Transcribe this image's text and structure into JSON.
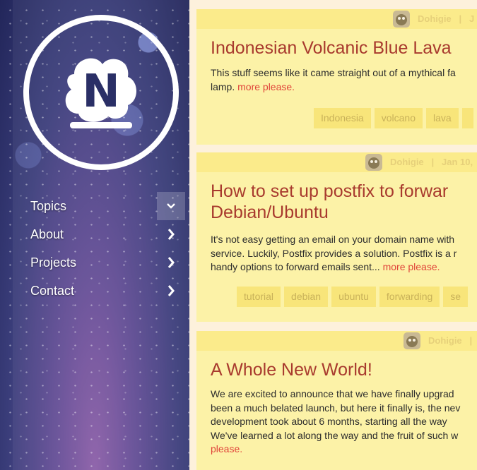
{
  "sidebar": {
    "logo_letter": "N",
    "nav": [
      {
        "label": "Topics",
        "icon": "chevron-down-icon"
      },
      {
        "label": "About",
        "icon": "chevron-right-icon"
      },
      {
        "label": "Projects",
        "icon": "chevron-right-icon"
      },
      {
        "label": "Contact",
        "icon": "chevron-right-icon"
      }
    ]
  },
  "posts": [
    {
      "author": "Dohigie",
      "date": "J",
      "title": "Indonesian Volcanic Blue Lava",
      "excerpt_lines": [
        "This stuff seems like it came straight out of a mythical fa",
        "lamp."
      ],
      "more": "more please.",
      "tags": [
        "Indonesia",
        "volcano",
        "lava"
      ]
    },
    {
      "author": "Dohigie",
      "date": "Jan 10,",
      "title_lines": [
        "How to set up postfix to forwar",
        "Debian/Ubuntu"
      ],
      "excerpt_lines": [
        "It's not easy getting an email on your domain name with",
        "service. Luckily, Postfix provides a solution. Postfix is a r",
        "handy options to forward emails sent..."
      ],
      "more": "more please.",
      "tags": [
        "tutorial",
        "debian",
        "ubuntu",
        "forwarding",
        "se"
      ]
    },
    {
      "author": "Dohigie",
      "date": "",
      "title": "A Whole New World!",
      "excerpt_lines": [
        "We are excited to announce that we have finally upgrad",
        "been a much belated launch, but here it finally is, the nev",
        "development took about 6 months, starting all the way",
        "We've learned a lot along the way and the fruit of such w"
      ],
      "more": "please.",
      "tags": []
    }
  ],
  "colors": {
    "accent_title": "#a83a2e",
    "link": "#e0443a",
    "card_bg": "#fcf2a7",
    "tag_bg": "#f8e57a"
  }
}
